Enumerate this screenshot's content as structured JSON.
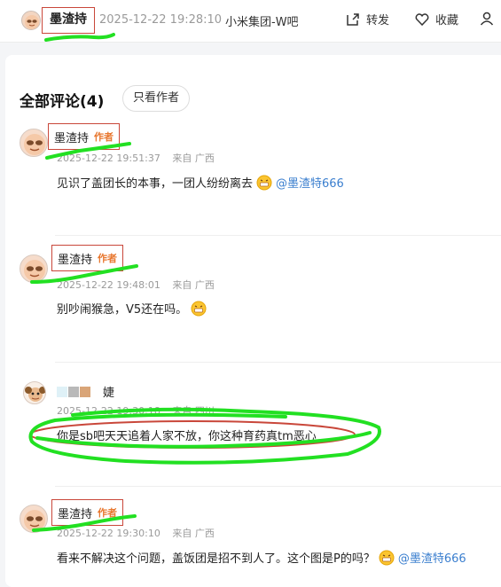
{
  "topbar": {
    "author": "墨渣持",
    "time": "2025-12-22 19:28:10",
    "forum": "小米集团-W吧",
    "share_label": "转发",
    "favorite_label": "收藏"
  },
  "comments_section": {
    "title": "全部评论(4)",
    "only_author_label": "只看作者"
  },
  "comments": [
    {
      "name": "墨渣持",
      "badge": "作者",
      "time": "2025-12-22 19:51:37",
      "location": "来自 广西",
      "text": "见识了盖团长的本事，一团人纷纷离去",
      "mention": "@墨渣特666"
    },
    {
      "name": "墨渣持",
      "badge": "作者",
      "time": "2025-12-22 19:48:01",
      "location": "来自 广西",
      "text": "别吵闹猴急，V5还在吗。",
      "mention": ""
    },
    {
      "name": "婕",
      "badge": "",
      "time": "2025-12-22 19:30:18",
      "location": "来自 四川",
      "text": "你是sb吧天天追着人家不放，你这种育药真tm恶心",
      "mention": ""
    },
    {
      "name": "墨渣持",
      "badge": "作者",
      "time": "2025-12-22 19:30:10",
      "location": "来自 广西",
      "text": "看来不解决这个问题，盖饭团是招不到人了。这个图是P的吗？",
      "mention": "@墨渣特666"
    }
  ],
  "colors": {
    "annotation_red": "#c9473a",
    "annotation_green": "#22e022",
    "author_badge": "#e8772e",
    "mention": "#3b7fcf"
  }
}
